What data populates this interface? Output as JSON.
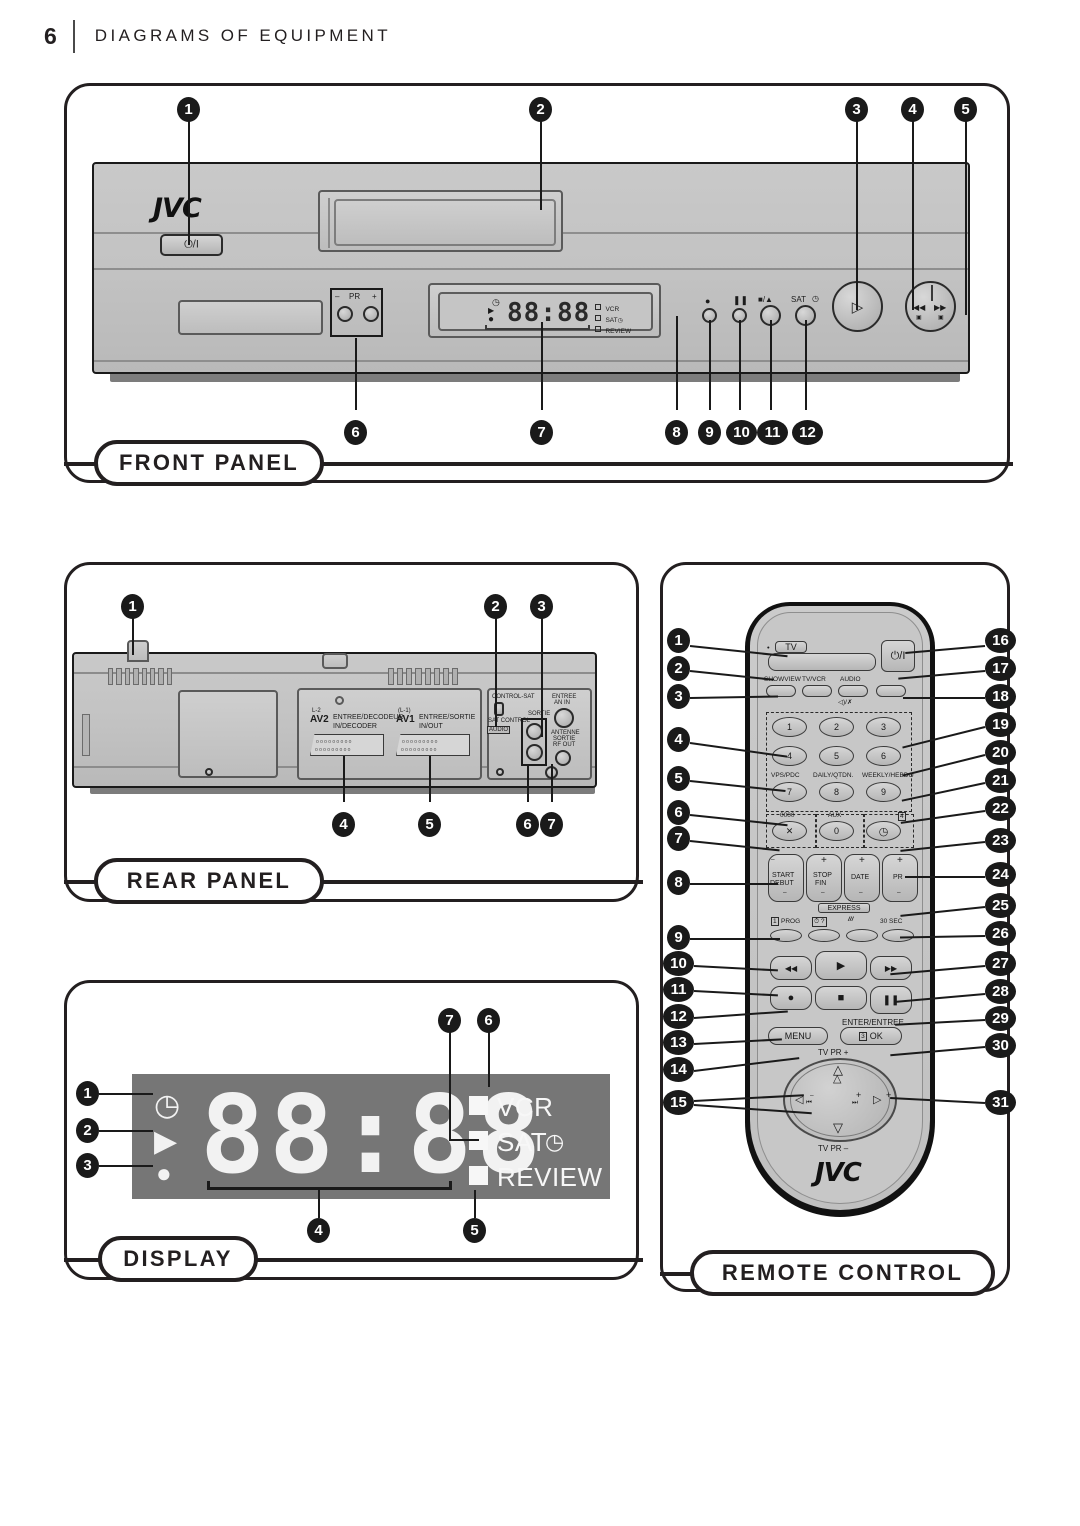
{
  "header": {
    "page_number": "6",
    "title": "DIAGRAMS OF EQUIPMENT"
  },
  "sections": {
    "front_panel": {
      "label": "FRONT PANEL",
      "brand": "JVC",
      "power_symbol": "⏻/I",
      "pr_label": "PR",
      "pr_minus": "–",
      "pr_plus": "+",
      "display": {
        "digits": "88:88",
        "indicators": [
          "VCR",
          "SAT",
          "REVIEW"
        ]
      },
      "buttons": {
        "record": "●",
        "pause": "❚❚",
        "stop_eject": "■/▲",
        "sat": "SAT",
        "play": "▷",
        "rew": "◀◀",
        "ff": "▶▶"
      },
      "callouts": [
        "1",
        "2",
        "3",
        "4",
        "5",
        "6",
        "7",
        "8",
        "9",
        "10",
        "11",
        "12"
      ]
    },
    "rear_panel": {
      "label": "REAR PANEL",
      "av2_code": "AV2",
      "av2_sub": "L-2",
      "av2_line1": "ENTREE/DECODEUR",
      "av2_line2": "IN/DECODER",
      "av1_code": "AV1",
      "av1_sub": "(L-1)",
      "av1_line1": "ENTREE/SORTIE",
      "av1_line2": "IN/OUT",
      "control_sat": "CONTROL-SAT",
      "sat_control": "SAT CONTROL",
      "sortie": "SORTIE",
      "audio": "AUDIO",
      "antenna_in1": "ENTREE",
      "antenna_in2": "AN IN",
      "antenna_out1": "ANTENNE",
      "antenna_out2": "SORTIE",
      "antenna_out3": "RF OUT",
      "callouts": [
        "1",
        "2",
        "3",
        "4",
        "5",
        "6",
        "7"
      ]
    },
    "display": {
      "label": "DISPLAY",
      "digits": "88:88",
      "indicators": [
        "VCR",
        "SAT",
        "REVIEW"
      ],
      "clock_icon": "clock-icon",
      "play_icon": "play-icon",
      "record_icon": "record-icon",
      "callouts": [
        "1",
        "2",
        "3",
        "4",
        "5",
        "6",
        "7"
      ]
    },
    "remote_control": {
      "label": "REMOTE CONTROL",
      "brand": "JVC",
      "buttons": {
        "tv": "TV",
        "power": "⏻/I",
        "showview": "SHOWVIEW",
        "tv_vcr": "TV/VCR",
        "audio": "AUDIO",
        "audio_sub": "◁)/✗",
        "num1": "1",
        "num2": "2",
        "num3": "3",
        "num4": "4",
        "num5": "5",
        "num6": "6",
        "num7": "7",
        "num8": "8",
        "num9": "9",
        "num0": "0",
        "cancel": "✕",
        "cancel_label": "0000",
        "vps_pdc": "VPS/PDC",
        "daily": "DAILY/QTDN.",
        "weekly": "WEEKLY/HEBDO",
        "aux": "AUX",
        "timer": "⏱",
        "timer_badge": "4",
        "start": "START",
        "start_sub": "DEBUT",
        "stop": "STOP",
        "stop_sub": "FIN",
        "date": "DATE",
        "pr": "PR",
        "plus": "+",
        "minus": "–",
        "express": "EXPRESS",
        "prog": "PROG",
        "prog_badge": "1",
        "help": "⏱ ?",
        "speed": "///",
        "thirty_sec": "30 SEC",
        "rew": "◀◀",
        "play": "▶",
        "ff": "▶▶",
        "record": "●",
        "stop_sq": "■",
        "pause": "❚❚",
        "menu": "MENU",
        "enter": "ENTER/ENTREE",
        "ok": "OK",
        "ok_badge": "3",
        "tv_pr_up": "TV  PR +",
        "tv_pr_down": "TV  PR –",
        "nav_up": "△",
        "nav_down": "▽",
        "nav_left": "◁",
        "nav_right": "▷",
        "skip_back": "⏮",
        "skip_fwd": "⏭"
      },
      "callouts_left": [
        "1",
        "2",
        "3",
        "4",
        "5",
        "6",
        "7",
        "8",
        "9",
        "10",
        "11",
        "12",
        "13",
        "14",
        "15"
      ],
      "callouts_right": [
        "16",
        "17",
        "18",
        "19",
        "20",
        "21",
        "22",
        "23",
        "24",
        "25",
        "26",
        "27",
        "28",
        "29",
        "30",
        "31"
      ]
    }
  },
  "colors": {
    "ink": "#231f20",
    "panel_gray": "#c3c3c3",
    "display_gray": "#767676",
    "callout_bg": "#1a1a1a"
  }
}
